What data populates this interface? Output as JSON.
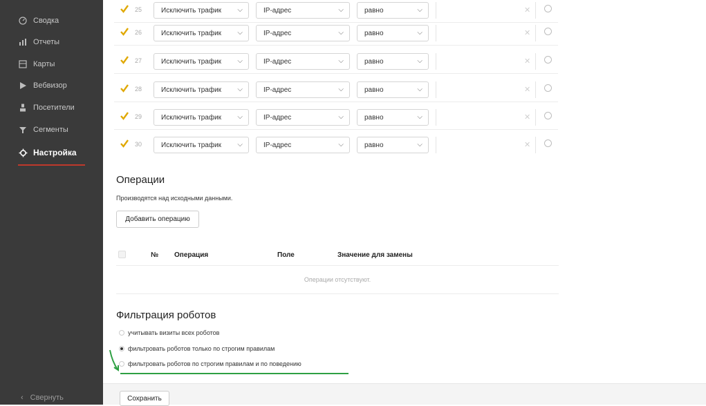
{
  "sidebar": {
    "items": [
      {
        "label": "Сводка",
        "icon": "dashboard-icon"
      },
      {
        "label": "Отчеты",
        "icon": "reports-icon"
      },
      {
        "label": "Карты",
        "icon": "maps-icon"
      },
      {
        "label": "Вебвизор",
        "icon": "play-icon"
      },
      {
        "label": "Посетители",
        "icon": "user-icon"
      },
      {
        "label": "Сегменты",
        "icon": "filter-icon"
      },
      {
        "label": "Настройка",
        "icon": "gear-icon"
      }
    ],
    "collapse_label": "Свернуть",
    "active_accent": "#c0392b"
  },
  "filter_rows": [
    {
      "num": "25",
      "action": "Исключить трафик",
      "field": "IP-адрес",
      "condition": "равно"
    },
    {
      "num": "26",
      "action": "Исключить трафик",
      "field": "IP-адрес",
      "condition": "равно"
    },
    {
      "num": "27",
      "action": "Исключить трафик",
      "field": "IP-адрес",
      "condition": "равно"
    },
    {
      "num": "28",
      "action": "Исключить трафик",
      "field": "IP-адрес",
      "condition": "равно"
    },
    {
      "num": "29",
      "action": "Исключить трафик",
      "field": "IP-адрес",
      "condition": "равно"
    },
    {
      "num": "30",
      "action": "Исключить трафик",
      "field": "IP-адрес",
      "condition": "равно"
    }
  ],
  "operations": {
    "title": "Операции",
    "description": "Производятся над исходными данными.",
    "add_button": "Добавить операцию",
    "columns": [
      "№",
      "Операция",
      "Поле",
      "Значение для замены"
    ],
    "empty_text": "Операции отсутствуют."
  },
  "robots": {
    "title": "Фильтрация роботов",
    "options": [
      {
        "label": "учитывать визиты всех роботов",
        "selected": false
      },
      {
        "label": "фильтровать роботов только по строгим правилам",
        "selected": true
      },
      {
        "label": "фильтровать роботов по строгим правилам и по поведению",
        "selected": false
      }
    ],
    "annotation_color": "#2ea043"
  },
  "footer": {
    "save_button": "Сохранить"
  },
  "colors": {
    "checkbox": "#e0a800",
    "sidebar_bg": "#3a3a3a"
  }
}
